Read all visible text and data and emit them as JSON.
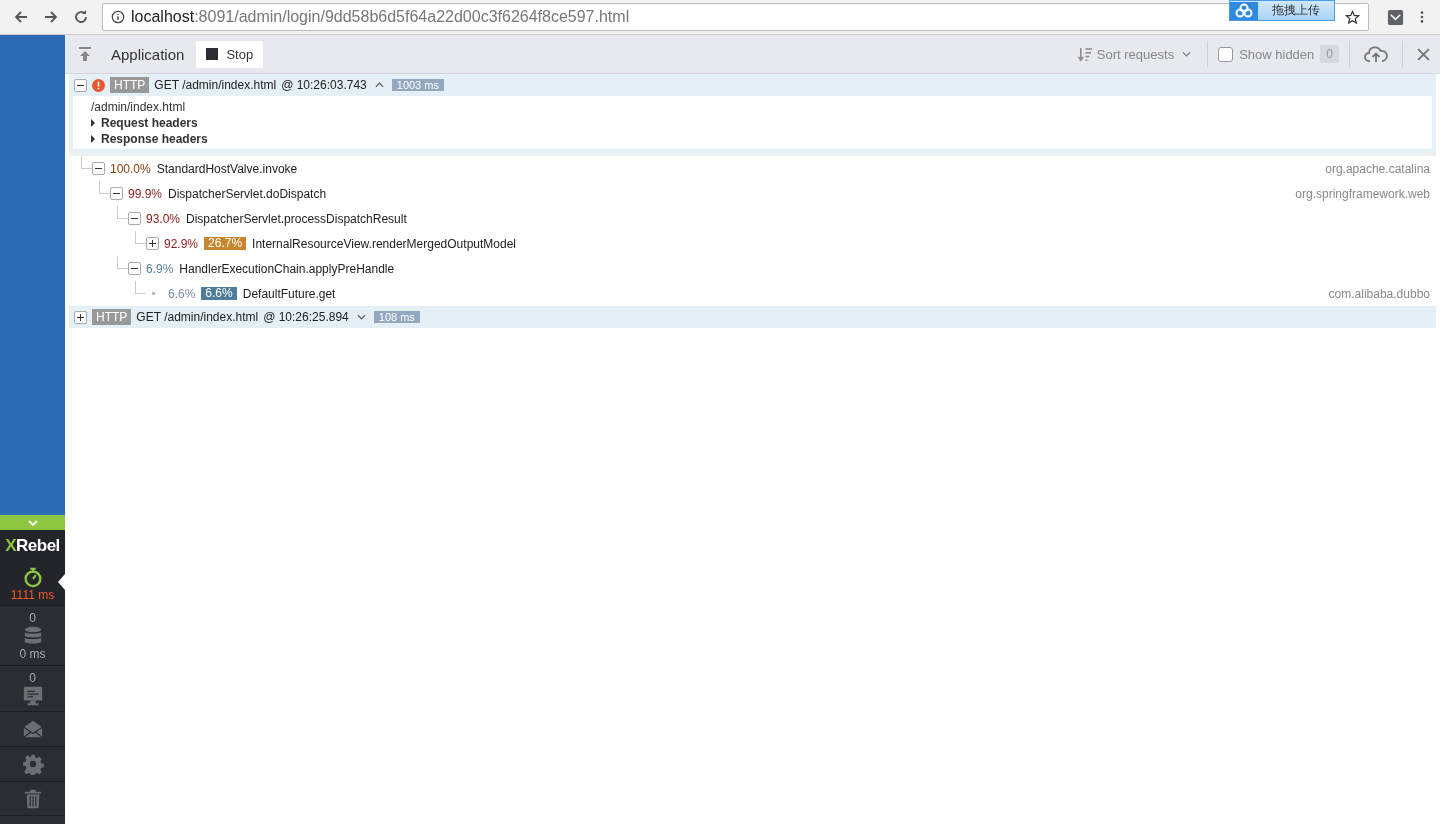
{
  "browser": {
    "url_host": "localhost",
    "url_rest": ":8091/admin/login/9dd58b6d5f64a22d00c3f6264f8ce597.html",
    "extension_label": "拖拽上传"
  },
  "sidebar": {
    "logo_x": "X",
    "logo_rest": "Rebel",
    "items": [
      {
        "kind": "timer",
        "value": "1111 ms",
        "selected": true
      },
      {
        "kind": "database",
        "count": "0",
        "value": "0 ms",
        "selected": false
      },
      {
        "kind": "monitor",
        "count": "0",
        "selected": false
      },
      {
        "kind": "mail",
        "selected": false
      },
      {
        "kind": "gear",
        "selected": false
      },
      {
        "kind": "trash",
        "selected": false
      }
    ]
  },
  "toolbar": {
    "title": "Application",
    "stop_label": "Stop",
    "sort_label": "Sort requests",
    "show_hidden": {
      "label": "Show hidden",
      "checked": false,
      "count": "0"
    }
  },
  "requests": [
    {
      "expanded": true,
      "error": true,
      "tag": "HTTP",
      "request": "GET /admin/index.html",
      "time": "@ 10:26:03.743",
      "duration": "1003 ms",
      "details": {
        "path": "/admin/index.html",
        "sections": [
          {
            "label": "Request headers",
            "expanded": false
          },
          {
            "label": "Response headers",
            "expanded": false
          }
        ]
      },
      "tree": [
        {
          "kind": "branch",
          "expanded": true,
          "percent": "100.0%",
          "color": "#8a3a10",
          "name": "StandardHostValve.invoke",
          "package": "org.apache.catalina",
          "children": [
            {
              "kind": "branch",
              "expanded": true,
              "percent": "99.9%",
              "color": "#8b1c1c",
              "name": "DispatcherServlet.doDispatch",
              "package": "org.springframework.web",
              "children": [
                {
                  "kind": "branch",
                  "expanded": true,
                  "percent": "93.0%",
                  "color": "#8b1c1c",
                  "name": "DispatcherServlet.processDispatchResult",
                  "children": [
                    {
                      "kind": "branch",
                      "expanded": false,
                      "percent": "92.9%",
                      "color": "#8b1c1c",
                      "badge": {
                        "text": "26.7%",
                        "color": "#c8862f"
                      },
                      "name": "InternalResourceView.renderMergedOutputModel"
                    }
                  ]
                },
                {
                  "kind": "branch",
                  "expanded": true,
                  "percent": "6.9%",
                  "color": "#5a7c9c",
                  "name": "HandlerExecutionChain.applyPreHandle",
                  "children": [
                    {
                      "kind": "leaf",
                      "percent": "6.6%",
                      "color": "#7c93a8",
                      "badge": {
                        "text": "6.6%",
                        "color": "#4f7d99"
                      },
                      "name": "DefaultFuture.get",
                      "package": "com.alibaba.dubbo"
                    }
                  ]
                }
              ]
            }
          ]
        }
      ]
    },
    {
      "expanded": false,
      "error": false,
      "tag": "HTTP",
      "request": "GET /admin/index.html",
      "time": "@ 10:26:25.894",
      "duration": "108 ms"
    }
  ]
}
